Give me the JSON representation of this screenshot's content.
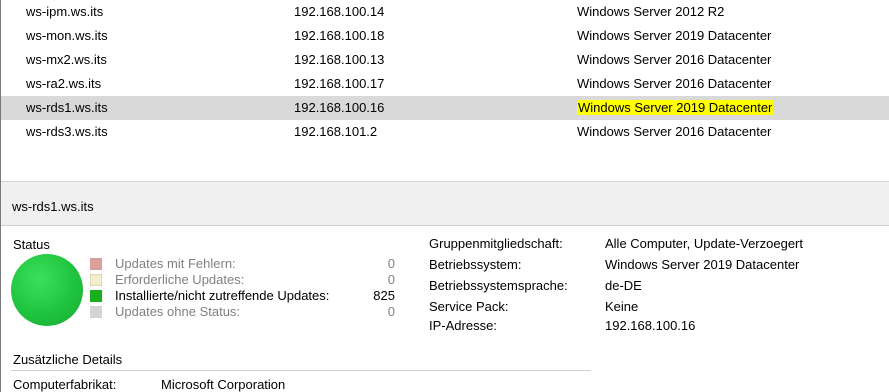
{
  "computers": [
    {
      "name": "ws-ipm.ws.its",
      "ip": "192.168.100.14",
      "os": "Windows Server 2012 R2"
    },
    {
      "name": "ws-mon.ws.its",
      "ip": "192.168.100.18",
      "os": "Windows Server 2019 Datacenter"
    },
    {
      "name": "ws-mx2.ws.its",
      "ip": "192.168.100.13",
      "os": "Windows Server 2016 Datacenter"
    },
    {
      "name": "ws-ra2.ws.its",
      "ip": "192.168.100.17",
      "os": "Windows Server 2016 Datacenter"
    },
    {
      "name": "ws-rds1.ws.its",
      "ip": "192.168.100.16",
      "os": "Windows Server 2019 Datacenter"
    },
    {
      "name": "ws-rds3.ws.its",
      "ip": "192.168.101.2",
      "os": "Windows Server 2016 Datacenter"
    }
  ],
  "selected_computer": "ws-rds1.ws.its",
  "colors": {
    "selection_row": "#d9d9d9",
    "highlight": "#ffff00",
    "status_circle": "#1fc43e",
    "error_box": "#d9a0a0",
    "required_box": "#f2edcc",
    "installed_box": "#19b01d",
    "nostatus_box": "#d4d4d4"
  },
  "details": {
    "status_title": "Status",
    "status_icon": "green-status-circle",
    "legend": [
      {
        "label": "Updates mit Fehlern:",
        "count": "0"
      },
      {
        "label": "Erforderliche Updates:",
        "count": "0"
      },
      {
        "label": "Installierte/nicht zutreffende Updates:",
        "count": "825"
      },
      {
        "label": "Updates ohne Status:",
        "count": "0"
      }
    ],
    "properties": [
      {
        "label": "Gruppenmitgliedschaft:",
        "value": "Alle Computer, Update-Verzoegert"
      },
      {
        "label": "Betriebssystem:",
        "value": "Windows Server 2019 Datacenter"
      },
      {
        "label": "Betriebssystemsprache:",
        "value": "de-DE"
      },
      {
        "label": "Service Pack:",
        "value": "Keine"
      },
      {
        "label": "IP-Adresse:",
        "value": "192.168.100.16"
      }
    ],
    "extra_title": "Zusätzliche Details",
    "manufacturer_label": "Computerfabrikat:",
    "manufacturer_value": "Microsoft Corporation"
  }
}
